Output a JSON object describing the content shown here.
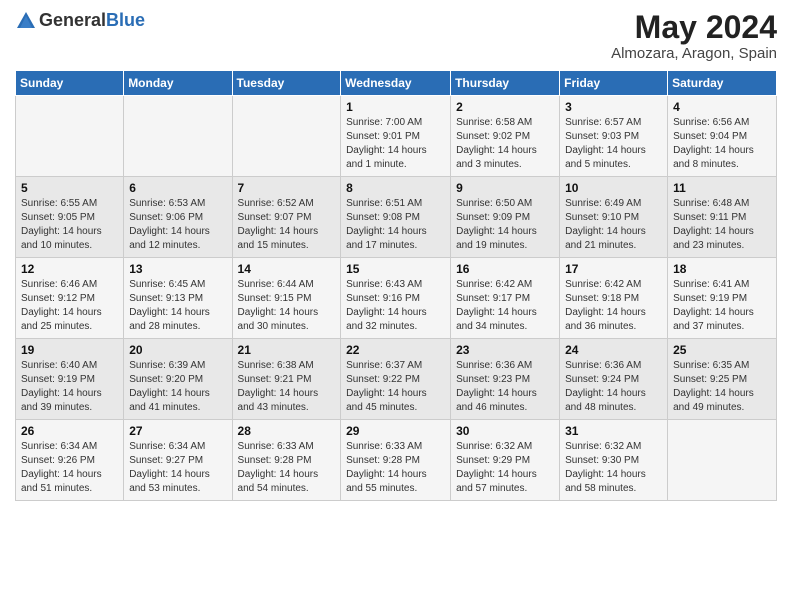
{
  "header": {
    "logo_general": "General",
    "logo_blue": "Blue",
    "month": "May 2024",
    "location": "Almozara, Aragon, Spain"
  },
  "weekdays": [
    "Sunday",
    "Monday",
    "Tuesday",
    "Wednesday",
    "Thursday",
    "Friday",
    "Saturday"
  ],
  "weeks": [
    [
      {
        "day": "",
        "info": ""
      },
      {
        "day": "",
        "info": ""
      },
      {
        "day": "",
        "info": ""
      },
      {
        "day": "1",
        "info": "Sunrise: 7:00 AM\nSunset: 9:01 PM\nDaylight: 14 hours\nand 1 minute."
      },
      {
        "day": "2",
        "info": "Sunrise: 6:58 AM\nSunset: 9:02 PM\nDaylight: 14 hours\nand 3 minutes."
      },
      {
        "day": "3",
        "info": "Sunrise: 6:57 AM\nSunset: 9:03 PM\nDaylight: 14 hours\nand 5 minutes."
      },
      {
        "day": "4",
        "info": "Sunrise: 6:56 AM\nSunset: 9:04 PM\nDaylight: 14 hours\nand 8 minutes."
      }
    ],
    [
      {
        "day": "5",
        "info": "Sunrise: 6:55 AM\nSunset: 9:05 PM\nDaylight: 14 hours\nand 10 minutes."
      },
      {
        "day": "6",
        "info": "Sunrise: 6:53 AM\nSunset: 9:06 PM\nDaylight: 14 hours\nand 12 minutes."
      },
      {
        "day": "7",
        "info": "Sunrise: 6:52 AM\nSunset: 9:07 PM\nDaylight: 14 hours\nand 15 minutes."
      },
      {
        "day": "8",
        "info": "Sunrise: 6:51 AM\nSunset: 9:08 PM\nDaylight: 14 hours\nand 17 minutes."
      },
      {
        "day": "9",
        "info": "Sunrise: 6:50 AM\nSunset: 9:09 PM\nDaylight: 14 hours\nand 19 minutes."
      },
      {
        "day": "10",
        "info": "Sunrise: 6:49 AM\nSunset: 9:10 PM\nDaylight: 14 hours\nand 21 minutes."
      },
      {
        "day": "11",
        "info": "Sunrise: 6:48 AM\nSunset: 9:11 PM\nDaylight: 14 hours\nand 23 minutes."
      }
    ],
    [
      {
        "day": "12",
        "info": "Sunrise: 6:46 AM\nSunset: 9:12 PM\nDaylight: 14 hours\nand 25 minutes."
      },
      {
        "day": "13",
        "info": "Sunrise: 6:45 AM\nSunset: 9:13 PM\nDaylight: 14 hours\nand 28 minutes."
      },
      {
        "day": "14",
        "info": "Sunrise: 6:44 AM\nSunset: 9:15 PM\nDaylight: 14 hours\nand 30 minutes."
      },
      {
        "day": "15",
        "info": "Sunrise: 6:43 AM\nSunset: 9:16 PM\nDaylight: 14 hours\nand 32 minutes."
      },
      {
        "day": "16",
        "info": "Sunrise: 6:42 AM\nSunset: 9:17 PM\nDaylight: 14 hours\nand 34 minutes."
      },
      {
        "day": "17",
        "info": "Sunrise: 6:42 AM\nSunset: 9:18 PM\nDaylight: 14 hours\nand 36 minutes."
      },
      {
        "day": "18",
        "info": "Sunrise: 6:41 AM\nSunset: 9:19 PM\nDaylight: 14 hours\nand 37 minutes."
      }
    ],
    [
      {
        "day": "19",
        "info": "Sunrise: 6:40 AM\nSunset: 9:19 PM\nDaylight: 14 hours\nand 39 minutes."
      },
      {
        "day": "20",
        "info": "Sunrise: 6:39 AM\nSunset: 9:20 PM\nDaylight: 14 hours\nand 41 minutes."
      },
      {
        "day": "21",
        "info": "Sunrise: 6:38 AM\nSunset: 9:21 PM\nDaylight: 14 hours\nand 43 minutes."
      },
      {
        "day": "22",
        "info": "Sunrise: 6:37 AM\nSunset: 9:22 PM\nDaylight: 14 hours\nand 45 minutes."
      },
      {
        "day": "23",
        "info": "Sunrise: 6:36 AM\nSunset: 9:23 PM\nDaylight: 14 hours\nand 46 minutes."
      },
      {
        "day": "24",
        "info": "Sunrise: 6:36 AM\nSunset: 9:24 PM\nDaylight: 14 hours\nand 48 minutes."
      },
      {
        "day": "25",
        "info": "Sunrise: 6:35 AM\nSunset: 9:25 PM\nDaylight: 14 hours\nand 49 minutes."
      }
    ],
    [
      {
        "day": "26",
        "info": "Sunrise: 6:34 AM\nSunset: 9:26 PM\nDaylight: 14 hours\nand 51 minutes."
      },
      {
        "day": "27",
        "info": "Sunrise: 6:34 AM\nSunset: 9:27 PM\nDaylight: 14 hours\nand 53 minutes."
      },
      {
        "day": "28",
        "info": "Sunrise: 6:33 AM\nSunset: 9:28 PM\nDaylight: 14 hours\nand 54 minutes."
      },
      {
        "day": "29",
        "info": "Sunrise: 6:33 AM\nSunset: 9:28 PM\nDaylight: 14 hours\nand 55 minutes."
      },
      {
        "day": "30",
        "info": "Sunrise: 6:32 AM\nSunset: 9:29 PM\nDaylight: 14 hours\nand 57 minutes."
      },
      {
        "day": "31",
        "info": "Sunrise: 6:32 AM\nSunset: 9:30 PM\nDaylight: 14 hours\nand 58 minutes."
      },
      {
        "day": "",
        "info": ""
      }
    ]
  ]
}
